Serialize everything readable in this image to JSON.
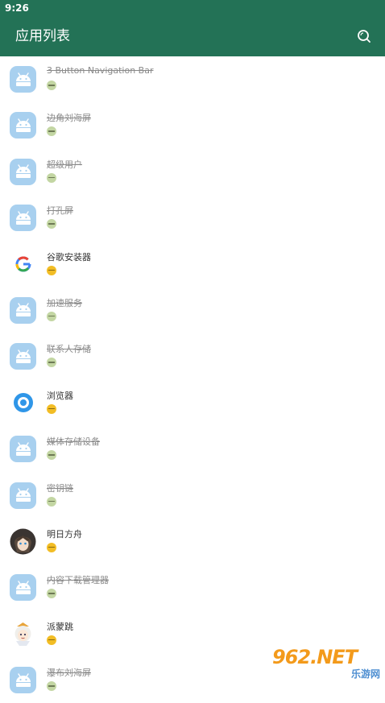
{
  "status_bar": {
    "time": "9:26"
  },
  "app_bar": {
    "title": "应用列表",
    "search_icon": "search-icon"
  },
  "colors": {
    "primary": "#237256",
    "android_icon_bg": "#a8d0ef",
    "enabled_dot": "#f2bd25",
    "disabled_dot": "#c3d6a3"
  },
  "apps": [
    {
      "name": "3 Button Navigation Bar",
      "icon": "android-icon",
      "status": "disabled"
    },
    {
      "name": "边角刘海屏",
      "icon": "android-icon",
      "status": "disabled"
    },
    {
      "name": "超级用户",
      "icon": "android-icon",
      "status": "disabled"
    },
    {
      "name": "打孔屏",
      "icon": "android-icon",
      "status": "disabled"
    },
    {
      "name": "谷歌安装器",
      "icon": "google-icon",
      "status": "enabled"
    },
    {
      "name": "加速服务",
      "icon": "android-icon",
      "status": "disabled"
    },
    {
      "name": "联系人存储",
      "icon": "android-icon",
      "status": "disabled"
    },
    {
      "name": "浏览器",
      "icon": "browser-icon",
      "status": "enabled"
    },
    {
      "name": "媒体存储设备",
      "icon": "android-icon",
      "status": "disabled"
    },
    {
      "name": "密钥链",
      "icon": "android-icon",
      "status": "disabled"
    },
    {
      "name": "明日方舟",
      "icon": "arknights-icon",
      "status": "enabled"
    },
    {
      "name": "内容下载管理器",
      "icon": "android-icon",
      "status": "disabled"
    },
    {
      "name": "派蒙跳",
      "icon": "paimon-icon",
      "status": "enabled"
    },
    {
      "name": "瀑布刘海屏",
      "icon": "android-icon",
      "status": "disabled"
    }
  ],
  "watermark": {
    "main": "962.NET",
    "sub": "乐游网"
  }
}
